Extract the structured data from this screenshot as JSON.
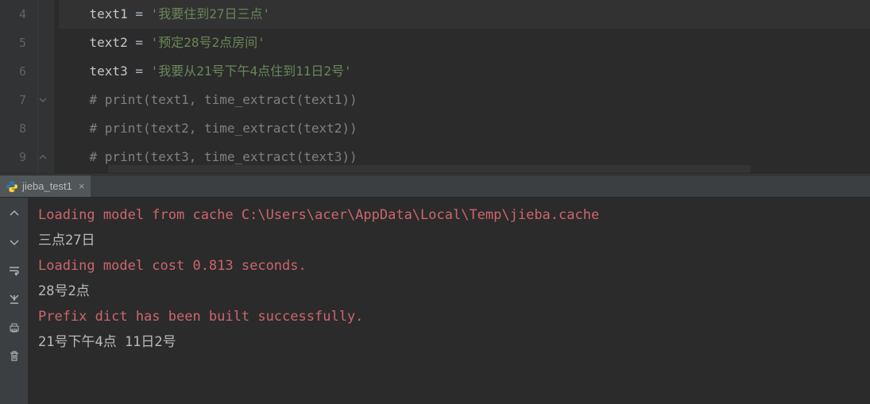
{
  "editor": {
    "lines": [
      {
        "num": "4",
        "segments": [
          {
            "cls": "var",
            "t": "text1"
          },
          {
            "cls": "op",
            "t": " = "
          },
          {
            "cls": "str",
            "t": "'我要住到27日三点'"
          }
        ],
        "hl": true
      },
      {
        "num": "5",
        "segments": [
          {
            "cls": "var",
            "t": "text2"
          },
          {
            "cls": "op",
            "t": " = "
          },
          {
            "cls": "str",
            "t": "'预定28号2点房间'"
          }
        ]
      },
      {
        "num": "6",
        "segments": [
          {
            "cls": "var",
            "t": "text3"
          },
          {
            "cls": "op",
            "t": " = "
          },
          {
            "cls": "str",
            "t": "'我要从21号下午4点住到11日2号'"
          }
        ]
      },
      {
        "num": "7",
        "fold": "open",
        "segments": [
          {
            "cls": "cmt",
            "t": "# print(text1, time_extract(text1))"
          }
        ]
      },
      {
        "num": "8",
        "segments": [
          {
            "cls": "cmt",
            "t": "# print(text2, time_extract(text2))"
          }
        ]
      },
      {
        "num": "9",
        "fold": "close",
        "segments": [
          {
            "cls": "cmt",
            "t": "# print(text3, time_extract(text3))"
          }
        ]
      }
    ],
    "indent": "    "
  },
  "runTab": {
    "name": "jieba_test1"
  },
  "console": {
    "lines": [
      {
        "cls": "red",
        "t": "Loading model from cache C:\\Users\\acer\\AppData\\Local\\Temp\\jieba.cache"
      },
      {
        "cls": "wht",
        "t": "三点27日"
      },
      {
        "cls": "red",
        "t": "Loading model cost 0.813 seconds."
      },
      {
        "cls": "wht",
        "t": "28号2点"
      },
      {
        "cls": "red",
        "t": "Prefix dict has been built successfully."
      },
      {
        "cls": "wht",
        "t": "21号下午4点 11日2号"
      }
    ]
  },
  "toolIcons": [
    "up-icon",
    "down-icon",
    "wrap-icon",
    "scroll-end-icon",
    "print-icon",
    "trash-icon"
  ]
}
